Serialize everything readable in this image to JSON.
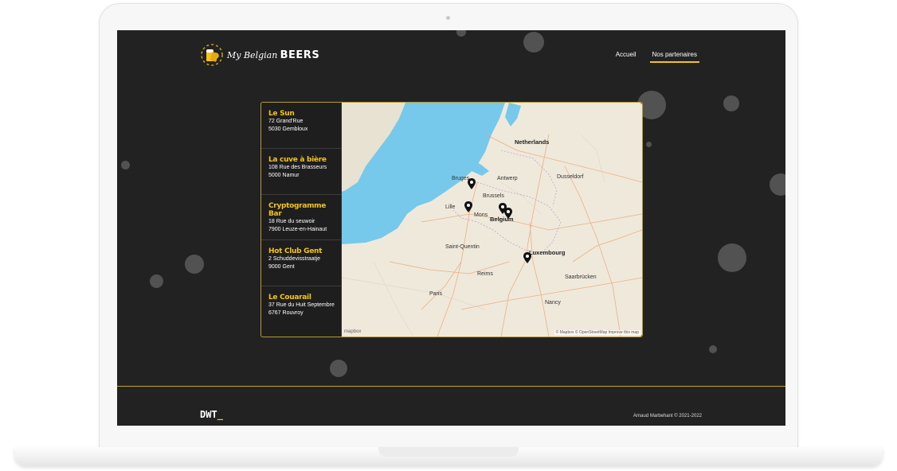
{
  "header": {
    "logo_script": "My Belgian",
    "logo_bold": "BEERS",
    "nav": [
      {
        "label": "Accueil",
        "active": false
      },
      {
        "label": "Nos partenaires",
        "active": true
      }
    ]
  },
  "partners": [
    {
      "name": "Le Sun",
      "street": "72 Grand'Rue",
      "city": "5030 Gembloux"
    },
    {
      "name": "La cuve à bière",
      "street": "108 Rue des Brasseurs",
      "city": "5000 Namur"
    },
    {
      "name": "Cryptogramme Bar",
      "street": "18 Rue du seuwoir",
      "city": "7900 Leuze-en-Hainaut"
    },
    {
      "name": "Hot Club Gent",
      "street": "2 Schuddevisstraatje",
      "city": "9000 Gent"
    },
    {
      "name": "Le Couarail",
      "street": "37 Rue du Huit Septembre",
      "city": "6767 Rouvroy"
    }
  ],
  "map": {
    "labels": {
      "netherlands": "Netherlands",
      "belgium": "Belgium",
      "luxembourg": "Luxembourg",
      "brussels": "Brussels",
      "paris": "Paris",
      "dusseldorf": "Dusseldorf",
      "antwerp": "Antwerp",
      "lille": "Lille",
      "saint_quentin": "Saint-Quentin",
      "reims": "Reims",
      "saarbrucken": "Saarbrücken",
      "nancy": "Nancy",
      "bruges": "Bruges",
      "mons": "Mons"
    },
    "attribution": "© Mapbox © OpenStreetMap Improve this map",
    "provider": "mapbox"
  },
  "footer": {
    "logo": "DWT",
    "cursor": "_",
    "copyright": "Arnaud Marbehant © 2021-2022"
  },
  "colors": {
    "accent": "#f3c41c",
    "background": "#222222",
    "sea": "#76c9ea",
    "land": "#efe9dc"
  }
}
